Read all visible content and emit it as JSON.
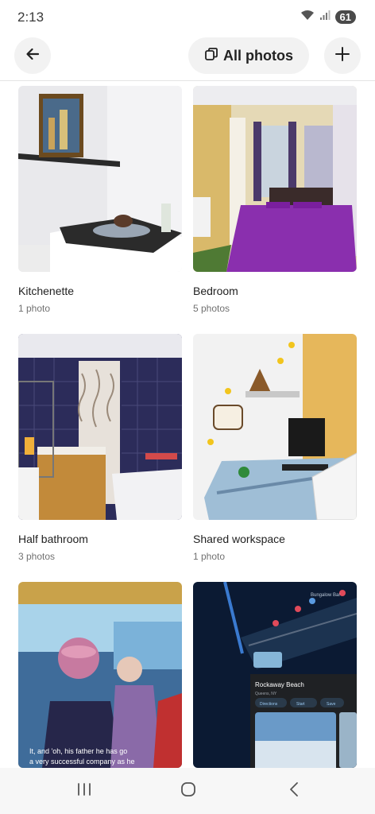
{
  "status": {
    "time": "2:13",
    "battery": "61"
  },
  "header": {
    "title": "All photos",
    "back_icon": "arrow-left-icon",
    "add_icon": "plus-icon",
    "pill_icon": "photos-stack-icon"
  },
  "rooms": [
    {
      "title": "Kitchenette",
      "count": "1 photo"
    },
    {
      "title": "Bedroom",
      "count": "5 photos"
    },
    {
      "title": "Half bathroom",
      "count": "3 photos"
    },
    {
      "title": "Shared workspace",
      "count": "1 photo"
    }
  ],
  "bottom_photos": {
    "photo_caption_lines": [
      "It, and 'oh, his father he has go",
      "a very successful company as he"
    ],
    "map_place": "Rockaway Beach",
    "map_sub": "Queens, NY",
    "map_actions": [
      "Directions",
      "Start",
      "Save"
    ],
    "map_badge": "Bungalow Bar"
  },
  "nav": {
    "recents_icon": "recents-icon",
    "home_icon": "home-icon",
    "back_icon": "back-icon"
  }
}
